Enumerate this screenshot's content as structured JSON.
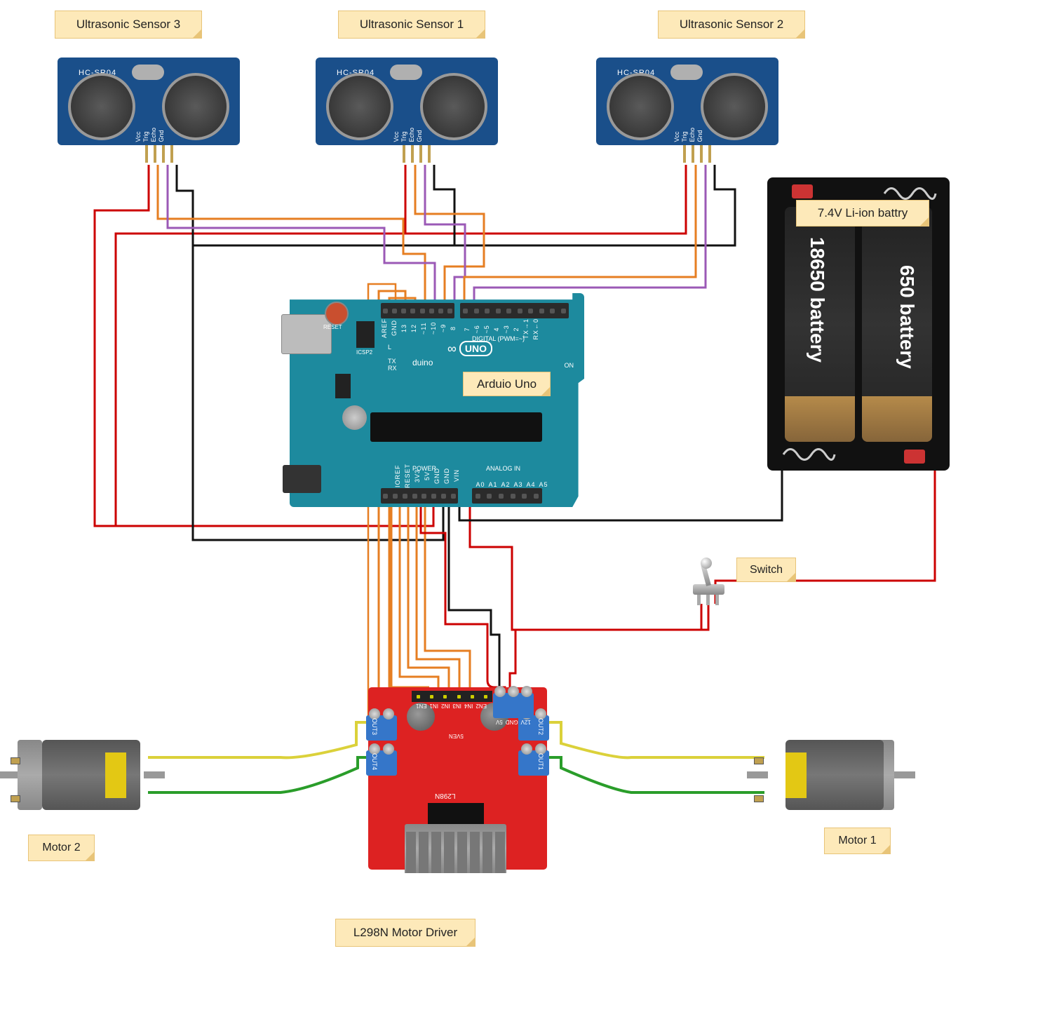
{
  "labels": {
    "sensor3": "Ultrasonic Sensor 3",
    "sensor1": "Ultrasonic Sensor 1",
    "sensor2": "Ultrasonic Sensor 2",
    "battery": "7.4V Li-ion battry",
    "arduino": "Arduio Uno",
    "switch": "Switch",
    "motor2": "Motor 2",
    "motor1": "Motor 1",
    "driver": "L298N Motor Driver"
  },
  "hcsr04": {
    "model": "HC-SR04",
    "pins": [
      "Vcc",
      "Trig",
      "Echo",
      "Gnd"
    ]
  },
  "arduino": {
    "brand": "duino",
    "model": "UNO",
    "silkscreen_top": [
      "AREF",
      "GND",
      "13",
      "12",
      "~11",
      "~10",
      "~9",
      "8",
      "7",
      "~6",
      "~5",
      "4",
      "~3",
      "2",
      "TX→1",
      "RX←0"
    ],
    "silkscreen_bot_left": [
      "IOREF",
      "RESET",
      "3V3",
      "5V",
      "GND",
      "GND",
      "VIN"
    ],
    "silkscreen_bot_right": [
      "A0",
      "A1",
      "A2",
      "A3",
      "A4",
      "A5"
    ],
    "section_labels": {
      "reset": "RESET",
      "icsp": "ICSP2",
      "digital": "DIGITAL (PWM=~)",
      "power": "POWER",
      "analog": "ANALOG IN",
      "tx": "TX",
      "rx": "RX",
      "l": "L",
      "on": "ON"
    }
  },
  "l298": {
    "chip": "L298N",
    "pin_labels_top": [
      "EN1",
      "IN1",
      "IN2",
      "IN3",
      "IN4",
      "EN2"
    ],
    "pin_labels_power": [
      "5V",
      "GND",
      "12V"
    ],
    "out_labels": [
      "OUT1",
      "OUT2",
      "OUT3",
      "OUT4"
    ],
    "misc": "5VEN"
  },
  "battery_cells": {
    "text1": "18650 battery",
    "text2": "650 battery"
  }
}
